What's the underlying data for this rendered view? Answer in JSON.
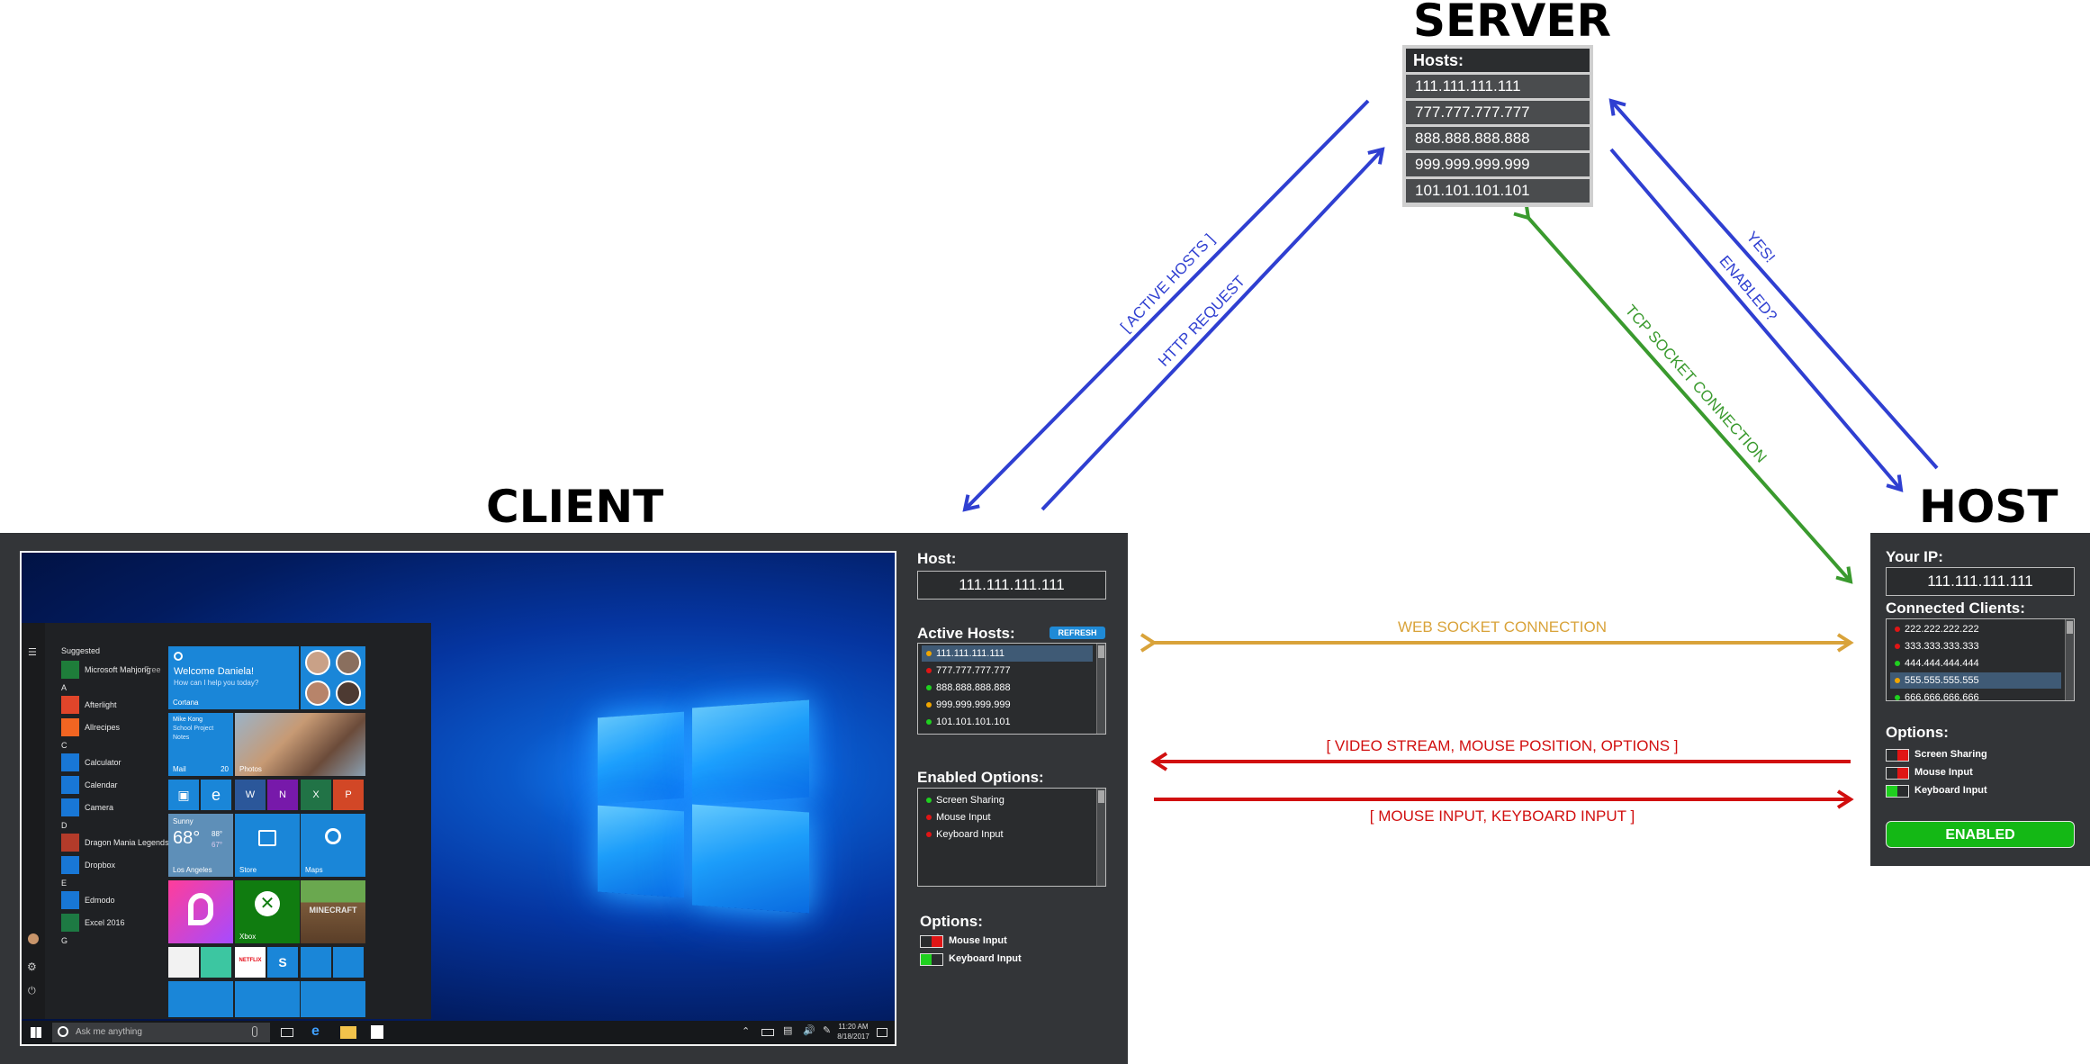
{
  "titles": {
    "server": "SERVER",
    "client": "CLIENT",
    "host": "HOST"
  },
  "server": {
    "header": "Hosts:",
    "hosts": [
      "111.111.111.111",
      "777.777.777.777",
      "888.888.888.888",
      "999.999.999.999",
      "101.101.101.101"
    ]
  },
  "arrow_labels": {
    "active_hosts": "[ ACTIVE HOSTS ]",
    "http_request": "HTTP REQUEST",
    "tcp_socket": "TCP SOCKET CONNECTION",
    "yes": "YES!",
    "enabled_q": "ENABLED?",
    "web_socket": "WEB SOCKET CONNECTION",
    "video_stream": "[ VIDEO STREAM, MOUSE POSITION, OPTIONS ]",
    "mouse_keyboard": "[ MOUSE INPUT, KEYBOARD INPUT ]"
  },
  "colors": {
    "blue_arrow": "#2f3fd1",
    "green_arrow": "#3a9a2e",
    "gold_arrow": "#d9a33a",
    "red_arrow": "#d10f0f",
    "dot_green": "#1fd01f",
    "dot_red": "#e01515",
    "dot_orange": "#f0a500"
  },
  "client": {
    "host_label": "Host:",
    "host_ip": "111.111.111.111",
    "active_hosts_label": "Active Hosts:",
    "refresh_label": "REFRESH",
    "active_hosts": [
      {
        "ip": "111.111.111.111",
        "status": "orange",
        "selected": true
      },
      {
        "ip": "777.777.777.777",
        "status": "red",
        "selected": false
      },
      {
        "ip": "888.888.888.888",
        "status": "green",
        "selected": false
      },
      {
        "ip": "999.999.999.999",
        "status": "orange",
        "selected": false
      },
      {
        "ip": "101.101.101.101",
        "status": "green",
        "selected": false
      }
    ],
    "enabled_options_label": "Enabled Options:",
    "enabled_options": [
      {
        "label": "Screen Sharing",
        "status": "green"
      },
      {
        "label": "Mouse Input",
        "status": "red"
      },
      {
        "label": "Keyboard Input",
        "status": "red"
      }
    ],
    "options_label": "Options:",
    "options": [
      {
        "label": "Mouse Input",
        "state": "off"
      },
      {
        "label": "Keyboard Input",
        "state": "on"
      }
    ]
  },
  "host": {
    "your_ip_label": "Your IP:",
    "your_ip": "111.111.111.111",
    "connected_clients_label": "Connected Clients:",
    "clients": [
      {
        "ip": "222.222.222.222",
        "status": "red",
        "selected": false
      },
      {
        "ip": "333.333.333.333",
        "status": "red",
        "selected": false
      },
      {
        "ip": "444.444.444.444",
        "status": "green",
        "selected": false
      },
      {
        "ip": "555.555.555.555",
        "status": "orange",
        "selected": true
      },
      {
        "ip": "666.666.666.666",
        "status": "green",
        "selected": false
      }
    ],
    "options_label": "Options:",
    "options": [
      {
        "label": "Screen Sharing",
        "state": "off"
      },
      {
        "label": "Mouse Input",
        "state": "off"
      },
      {
        "label": "Keyboard Input",
        "state": "on"
      }
    ],
    "enabled_button": "ENABLED"
  },
  "desktop": {
    "start_menu": {
      "suggested": "Suggested",
      "apps": [
        {
          "letter": "",
          "name": "Microsoft Mahjong",
          "extra": "Free",
          "color": "#1e7d3a"
        },
        {
          "letter": "A",
          "name": "Afterlight",
          "extra": "",
          "color": "#e0452a"
        },
        {
          "letter": "",
          "name": "Allrecipes",
          "extra": "",
          "color": "#f26522"
        },
        {
          "letter": "C",
          "name": "Calculator",
          "extra": "",
          "color": "#1877d6"
        },
        {
          "letter": "",
          "name": "Calendar",
          "extra": "",
          "color": "#1877d6"
        },
        {
          "letter": "",
          "name": "Camera",
          "extra": "",
          "color": "#1877d6"
        },
        {
          "letter": "D",
          "name": "Dragon Mania Legends",
          "extra": "",
          "color": "#b33b2a"
        },
        {
          "letter": "",
          "name": "Dropbox",
          "extra": "",
          "color": "#1877d6"
        },
        {
          "letter": "E",
          "name": "Edmodo",
          "extra": "",
          "color": "#1877d6"
        },
        {
          "letter": "",
          "name": "Excel 2016",
          "extra": "",
          "color": "#1d7a43"
        },
        {
          "letter": "G",
          "name": "",
          "extra": "",
          "color": ""
        }
      ],
      "cortana_title": "Welcome Daniela!",
      "cortana_sub": "How can I help you today?",
      "cortana_label": "Cortana",
      "mail_lines": [
        "Mike Kong",
        "School Project",
        "Notes"
      ],
      "mail_label": "Mail",
      "mail_count": "20",
      "photos_label": "Photos",
      "weather_cond": "Sunny",
      "weather_temp": "68°",
      "weather_hi": "88°",
      "weather_lo": "67°",
      "weather_city": "Los Angeles",
      "store_label": "Store",
      "maps_label": "Maps",
      "xbox_label": "Xbox",
      "minecraft_label": "MINECRAFT",
      "netflix_label": "NETFLIX"
    },
    "taskbar": {
      "search_placeholder": "Ask me anything",
      "time": "11:20 AM",
      "date": "8/18/2017"
    }
  }
}
